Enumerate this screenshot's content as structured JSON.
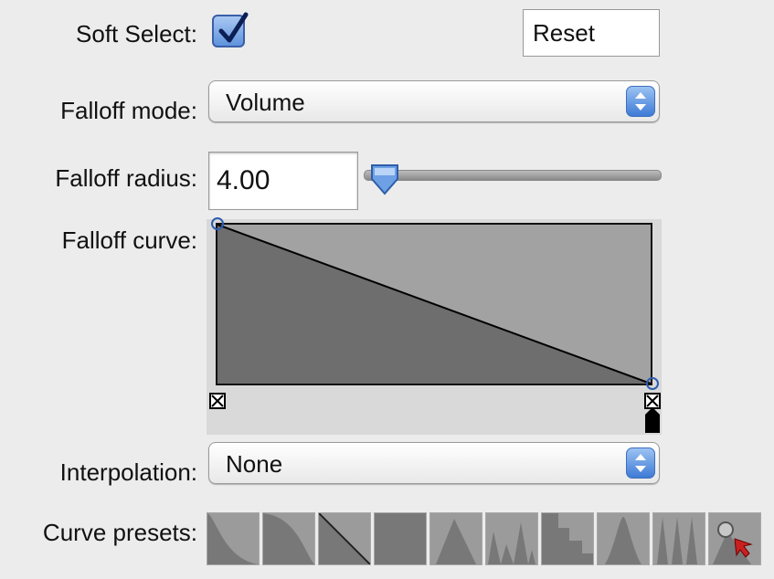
{
  "soft_select": {
    "label": "Soft Select:",
    "checked": true
  },
  "reset": {
    "label": "Reset"
  },
  "falloff_mode": {
    "label": "Falloff mode:",
    "value": "Volume"
  },
  "falloff_radius": {
    "label": "Falloff radius:",
    "value": "4.00",
    "slider_fraction": 0.08
  },
  "falloff_curve": {
    "label": "Falloff curve:"
  },
  "interpolation": {
    "label": "Interpolation:",
    "value": "None"
  },
  "curve_presets": {
    "label": "Curve presets:",
    "items": [
      {
        "name": "ease-out"
      },
      {
        "name": "ease-in"
      },
      {
        "name": "linear"
      },
      {
        "name": "flat"
      },
      {
        "name": "peak"
      },
      {
        "name": "multi-peak"
      },
      {
        "name": "stairs"
      },
      {
        "name": "bell"
      },
      {
        "name": "spikes"
      },
      {
        "name": "custom-pick"
      }
    ]
  },
  "colors": {
    "accent": "#4a86d8",
    "curve_fill_dark": "#6e6e6e",
    "curve_fill_light": "#a2a2a2"
  }
}
